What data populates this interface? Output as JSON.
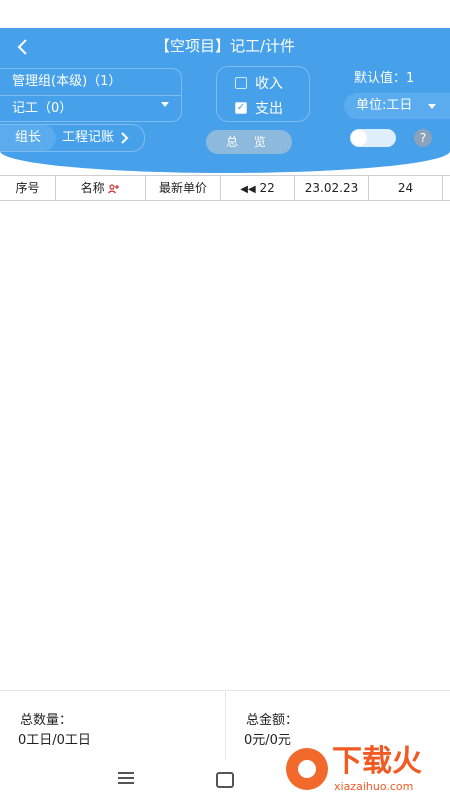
{
  "header": {
    "title": "【空项目】记工/计件",
    "group_line1": "管理组(本级)（1）",
    "group_line2": "记工（0）",
    "chip_leader": "组长",
    "chip_ledger": "工程记账",
    "income_label": "收入",
    "income_checked": false,
    "expense_label": "支出",
    "expense_checked": true,
    "default_value": "默认值：1",
    "unit_label": "单位:工日",
    "overview_label": "总 览",
    "help_symbol": "?",
    "toggle_on": false,
    "colors": {
      "primary": "#47a0ea",
      "accent": "#5aacef"
    }
  },
  "table": {
    "columns": [
      "序号",
      "名称",
      "最新单价",
      "22",
      "23.02.23",
      "24",
      ""
    ]
  },
  "footer": {
    "qty_label": "总数量：",
    "qty_value": "0工日/0工日",
    "amount_label": "总金额：",
    "amount_value": "0元/0元"
  },
  "watermark": {
    "text": "下载火",
    "sub": "xiazaihuo.com"
  }
}
